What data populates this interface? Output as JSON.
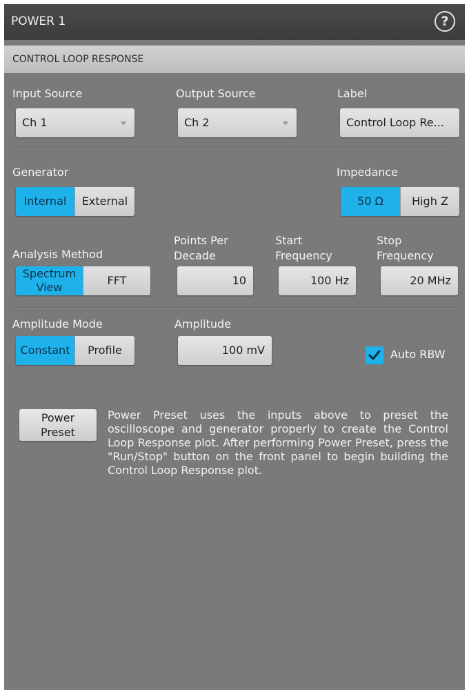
{
  "header": {
    "title": "POWER 1",
    "help_icon": "help-circle-icon"
  },
  "section": {
    "title": "CONTROL LOOP RESPONSE"
  },
  "input_source": {
    "label": "Input Source",
    "value": "Ch 1"
  },
  "output_source": {
    "label": "Output Source",
    "value": "Ch 2"
  },
  "label_field": {
    "label": "Label",
    "value": "Control Loop Re..."
  },
  "generator": {
    "label": "Generator",
    "options": [
      "Internal",
      "External"
    ],
    "selected": "Internal"
  },
  "impedance": {
    "label": "Impedance",
    "options": [
      "50 Ω",
      "High Z"
    ],
    "selected": "50 Ω"
  },
  "analysis_method": {
    "label": "Analysis Method",
    "options": [
      "Spectrum View",
      "FFT"
    ],
    "selected": "Spectrum View"
  },
  "points_per_decade": {
    "label_line1": "Points Per",
    "label_line2": "Decade",
    "value": "10"
  },
  "start_frequency": {
    "label_line1": "Start",
    "label_line2": "Frequency",
    "value": "100 Hz"
  },
  "stop_frequency": {
    "label_line1": "Stop",
    "label_line2": "Frequency",
    "value": "20 MHz"
  },
  "amplitude_mode": {
    "label": "Amplitude Mode",
    "options": [
      "Constant",
      "Profile"
    ],
    "selected": "Constant"
  },
  "amplitude": {
    "label": "Amplitude",
    "value": "100 mV"
  },
  "auto_rbw": {
    "label": "Auto RBW",
    "checked": true
  },
  "power_preset": {
    "button_line1": "Power",
    "button_line2": "Preset",
    "description": "Power Preset uses the inputs above to preset the oscilloscope and generator properly to create the Control Loop Response plot. After performing Power Preset, press the \"Run/Stop\" button on the front panel to begin building the Control Loop Response plot."
  },
  "colors": {
    "accent": "#1fb1ea",
    "panel": "#7a7a7a",
    "titlebar": "#3f3f3f",
    "section_bar": "#c8c8c8"
  }
}
